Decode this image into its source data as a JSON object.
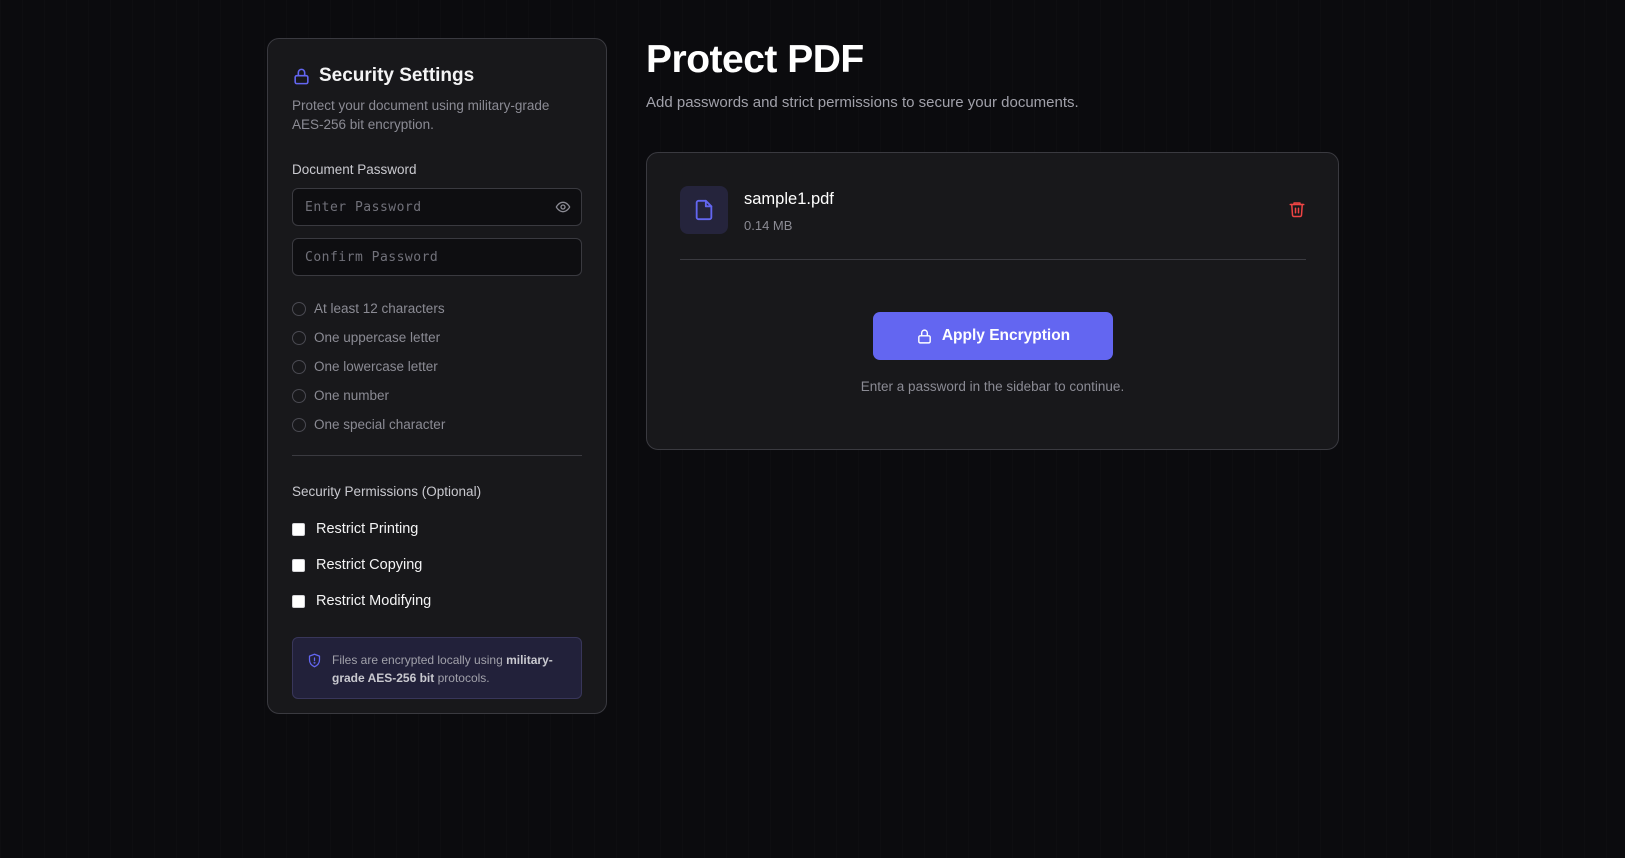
{
  "colors": {
    "accent": "#6366f1",
    "danger": "#ef4444",
    "background": "#0b0b0e",
    "panel": "#18181b"
  },
  "sidebar": {
    "icon": "lock-icon",
    "title": "Security Settings",
    "description": "Protect your document using military-grade AES-256 bit encryption.",
    "password_label": "Document Password",
    "password_placeholder": "Enter Password",
    "password_value": "",
    "confirm_placeholder": "Confirm Password",
    "confirm_value": "",
    "toggle_visibility_icon": "eye-icon",
    "requirements": [
      {
        "label": "At least 12 characters",
        "met": false
      },
      {
        "label": "One uppercase letter",
        "met": false
      },
      {
        "label": "One lowercase letter",
        "met": false
      },
      {
        "label": "One number",
        "met": false
      },
      {
        "label": "One special character",
        "met": false
      }
    ],
    "permissions_label": "Security Permissions (Optional)",
    "permissions": [
      {
        "label": "Restrict Printing",
        "checked": false
      },
      {
        "label": "Restrict Copying",
        "checked": false
      },
      {
        "label": "Restrict Modifying",
        "checked": false
      }
    ],
    "notice": {
      "icon": "shield-icon",
      "text_before": "Files are encrypted locally using ",
      "text_bold": "military-grade AES-256 bit",
      "text_after": " protocols."
    }
  },
  "main": {
    "title": "Protect PDF",
    "subtitle": "Add passwords and strict permissions to secure your documents.",
    "file": {
      "icon": "file-icon",
      "name": "sample1.pdf",
      "size": "0.14 MB",
      "remove_icon": "trash-icon"
    },
    "apply_button": {
      "icon": "lock-icon",
      "label": "Apply Encryption"
    },
    "hint": "Enter a password in the sidebar to continue."
  }
}
